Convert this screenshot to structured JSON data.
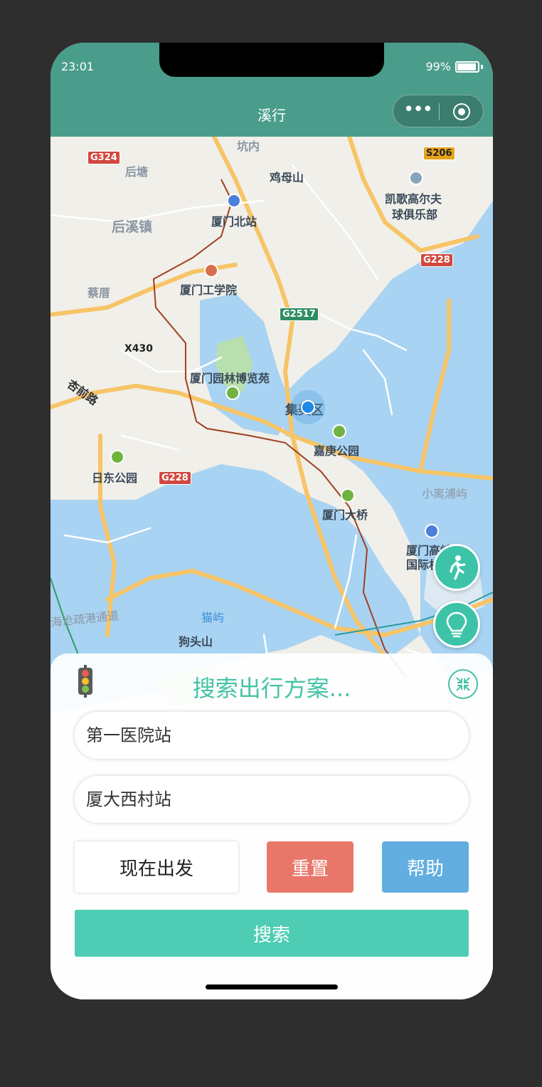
{
  "status": {
    "time": "23:01",
    "battery": "99%"
  },
  "nav": {
    "title": "溪行",
    "menu_icon": "more-dots-icon",
    "close_icon": "target-icon"
  },
  "map": {
    "labels": {
      "kengnei": "坑内",
      "houtang": "后塘",
      "jimushan": "鸡母山",
      "kaige": "凯歌高尔夫",
      "kaige2": "球俱乐部",
      "xiamenbei": "厦门北站",
      "houxizhen": "后溪镇",
      "caicuo": "蔡厝",
      "gongxueyuan": "厦门工学院",
      "x430": "X430",
      "xingqianlu": "杏前路",
      "yuanlin": "厦门园林博览苑",
      "jimei": "集美区",
      "jiageng": "嘉庚公园",
      "ridong": "日东公园",
      "xiaoli": "小离浦屿",
      "daqiao": "厦门大桥",
      "airport1": "厦门高崎",
      "airport2": "国际机场",
      "haicang": "海沧疏港通道",
      "maoyu": "猫屿",
      "goutou": "狗头山"
    },
    "shields": {
      "g324": "G324",
      "s206": "S206",
      "g228a": "G228",
      "g2517": "G2517",
      "g228b": "G228"
    }
  },
  "fabs": {
    "walk_icon": "walk-icon",
    "bulb_icon": "lightbulb-icon"
  },
  "panel": {
    "title": "搜索出行方案...",
    "traffic_icon": "traffic-light-icon",
    "collapse_icon": "collapse-icon",
    "from_value": "第一医院站",
    "to_value": "厦大西村站",
    "depart_label": "现在出发",
    "reset_label": "重置",
    "help_label": "帮助",
    "search_label": "搜索"
  },
  "colors": {
    "header": "#4a9d8b",
    "accent": "#45c3a6",
    "reset": "#e8776a",
    "help": "#62aee0",
    "search": "#4ecdb4"
  }
}
